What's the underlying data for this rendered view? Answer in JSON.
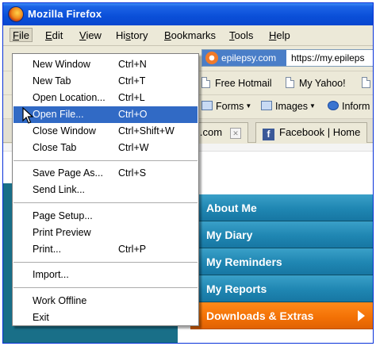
{
  "window": {
    "title": "Mozilla Firefox"
  },
  "menubar": [
    {
      "label": "File",
      "underline": "F"
    },
    {
      "label": "Edit",
      "underline": "E"
    },
    {
      "label": "View",
      "underline": "V"
    },
    {
      "label": "History",
      "underline": "s"
    },
    {
      "label": "Bookmarks",
      "underline": "B"
    },
    {
      "label": "Tools",
      "underline": "T"
    },
    {
      "label": "Help",
      "underline": "H"
    }
  ],
  "file_menu": {
    "items": [
      {
        "label": "New Window",
        "shortcut": "Ctrl+N"
      },
      {
        "label": "New Tab",
        "shortcut": "Ctrl+T"
      },
      {
        "label": "Open Location...",
        "shortcut": "Ctrl+L"
      },
      {
        "label": "Open File...",
        "shortcut": "Ctrl+O",
        "highlighted": true
      },
      {
        "label": "Close Window",
        "shortcut": "Ctrl+Shift+W"
      },
      {
        "label": "Close Tab",
        "shortcut": "Ctrl+W"
      },
      {
        "label": "Save Page As...",
        "shortcut": "Ctrl+S"
      },
      {
        "label": "Send Link...",
        "shortcut": ""
      },
      {
        "label": "Page Setup...",
        "shortcut": ""
      },
      {
        "label": "Print Preview",
        "shortcut": ""
      },
      {
        "label": "Print...",
        "shortcut": "Ctrl+P"
      },
      {
        "label": "Import...",
        "shortcut": ""
      },
      {
        "label": "Work Offline",
        "shortcut": ""
      },
      {
        "label": "Exit",
        "shortcut": ""
      }
    ]
  },
  "urlbar": {
    "site_badge": "epilepsy.com",
    "url": "https://my.epileps"
  },
  "bookmarks": [
    "Free Hotmail",
    "My Yahoo!"
  ],
  "toolbar": {
    "forms": "Forms",
    "images": "Images",
    "info": "Inform"
  },
  "tabs": [
    {
      "label": "l.com"
    },
    {
      "label": "Facebook | Home",
      "icon": "f"
    }
  ],
  "page_nav": [
    {
      "label": "About Me"
    },
    {
      "label": "My Diary"
    },
    {
      "label": "My Reminders"
    },
    {
      "label": "My Reports"
    },
    {
      "label": "Downloads & Extras"
    }
  ],
  "colors": {
    "titlebar": "#0a4fd8",
    "menu_highlight": "#316ac5",
    "nav_blue": "#1f86b2",
    "nav_orange": "#f27005",
    "left_panel": "#196f88"
  }
}
